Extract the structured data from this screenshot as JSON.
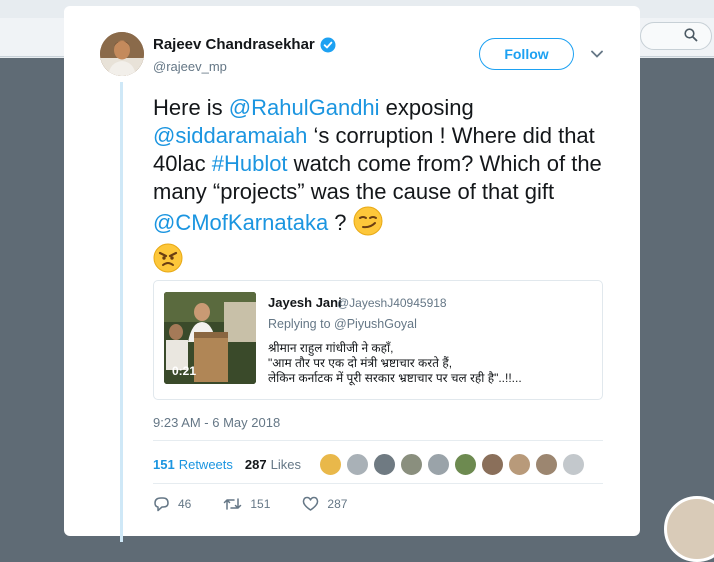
{
  "author": {
    "name": "Rajeev Chandrasekhar",
    "handle": "@rajeev_mp",
    "verified": true
  },
  "follow_label": "Follow",
  "tweet": {
    "segments": [
      {
        "text": "Here is ",
        "link": false
      },
      {
        "text": "@RahulGandhi",
        "link": true
      },
      {
        "text": " exposing ",
        "link": false
      },
      {
        "text": "@siddaramaiah",
        "link": true
      },
      {
        "text": " ‘s corruption ! Where did that 40lac ",
        "link": false
      },
      {
        "text": "#Hublot",
        "link": true
      },
      {
        "text": " watch come from? Which of the many “projects” was the cause of that gift ",
        "link": false
      },
      {
        "text": "@CMofKarnataka",
        "link": true
      },
      {
        "text": " ? ",
        "link": false
      }
    ],
    "emojis": [
      "smirking-face",
      "angry-face"
    ]
  },
  "quote": {
    "name": "Jayesh Jani",
    "handle": "@JayeshJ40945918",
    "replying_to": "Replying to @PiyushGoyal",
    "video_duration": "0:21",
    "lines": [
      "श्रीमान राहुल गांधीजी ने कहाँ,",
      "\"आम तौर पर एक दो मंत्री भ्रष्टाचार करते हैं,",
      "लेकिन कर्नाटक में पूरी सरकार भ्रष्टाचार पर चल रही है\"..!!..."
    ]
  },
  "timestamp": "9:23 AM - 6 May 2018",
  "stats": {
    "retweets": "151",
    "retweets_label": "Retweets",
    "likes": "287",
    "likes_label": "Likes",
    "liker_avatar_count": 10
  },
  "actions": {
    "replies": "46",
    "retweets": "151",
    "likes": "287"
  },
  "colors": {
    "link": "#1b95e0",
    "verified": "#1da1f2",
    "text": "#14171a",
    "muted": "#657786"
  }
}
